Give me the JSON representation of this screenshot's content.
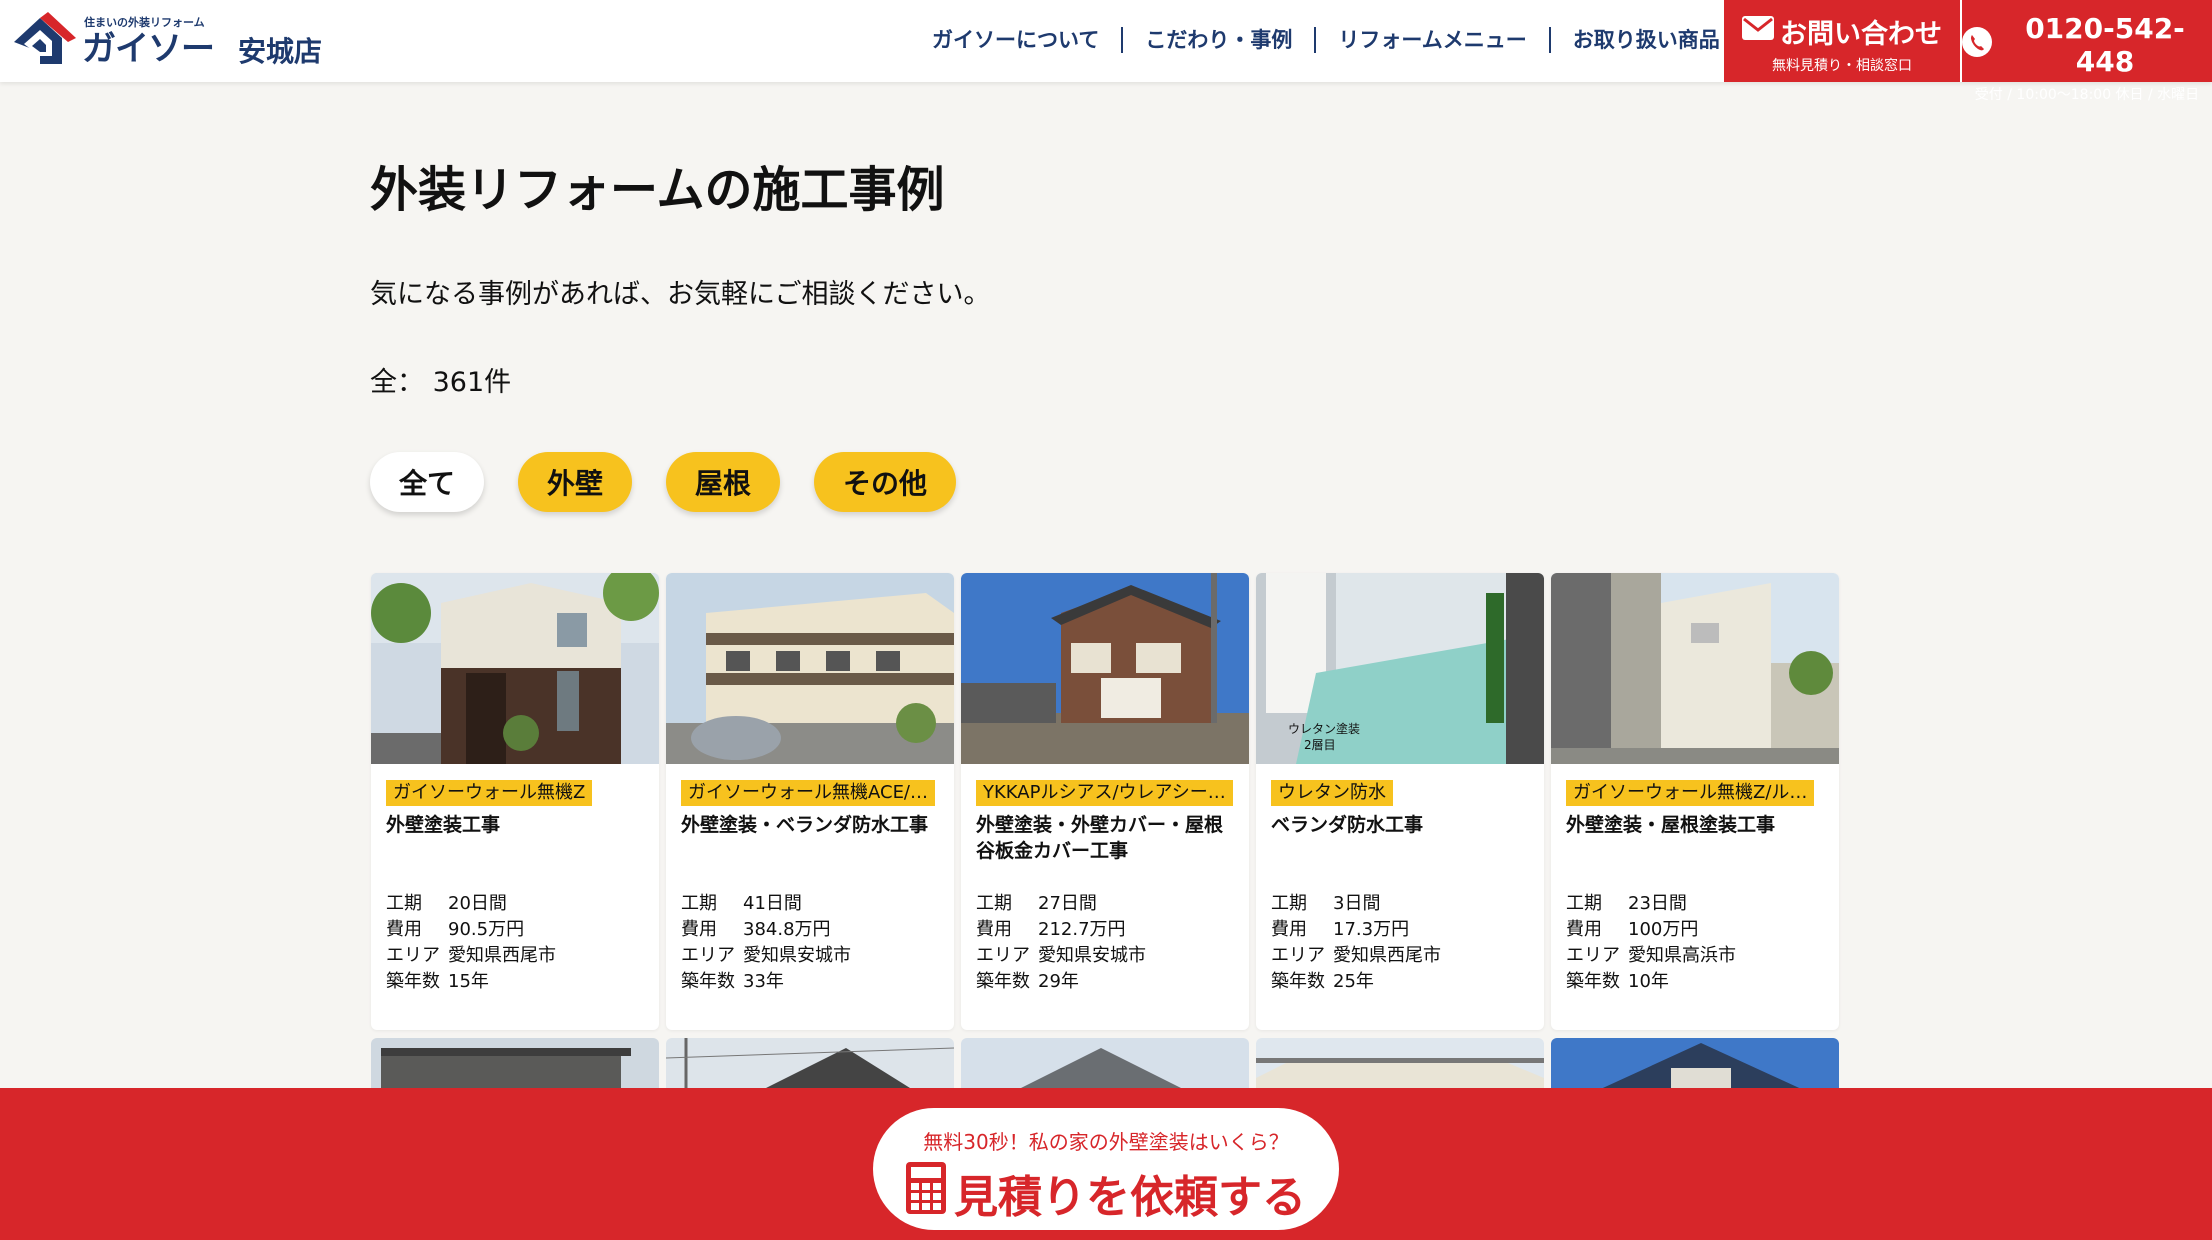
{
  "header": {
    "logo_tagline": "住まいの外装リフォーム",
    "logo_brand": "ガイソー",
    "store_name": "安城店",
    "nav": [
      "ガイソーについて",
      "こだわり・事例",
      "リフォームメニュー",
      "お取り扱い商品"
    ],
    "contact": {
      "label": "お問い合わせ",
      "sub": "無料見積り・相談窓口"
    },
    "tel": {
      "number": "0120-542-448",
      "sub": "受付 / 10:00〜18:00 休日 / 水曜日"
    }
  },
  "main": {
    "title": "外装リフォームの施工事例",
    "lead": "気になる事例があれば、お気軽にご相談ください。",
    "count": "全： 361件",
    "filters": [
      "全て",
      "外壁",
      "屋根",
      "その他"
    ]
  },
  "spec_labels": {
    "period": "工期",
    "cost": "費用",
    "area": "エリア",
    "age": "築年数"
  },
  "cases": [
    {
      "tag": "ガイソーウォール無機Z",
      "title": "外壁塗装工事",
      "period": "20日間",
      "cost": "90.5万円",
      "area": "愛知県西尾市",
      "age": "15年"
    },
    {
      "tag": "ガイソーウォール無機ACE/…",
      "title": "外壁塗装・ベランダ防水工事",
      "period": "41日間",
      "cost": "384.8万円",
      "area": "愛知県安城市",
      "age": "33年"
    },
    {
      "tag": "YKKAPルシアス/ウレアシー…",
      "title": "外壁塗装・外壁カバー・屋根谷板金カバー工事",
      "period": "27日間",
      "cost": "212.7万円",
      "area": "愛知県安城市",
      "age": "29年"
    },
    {
      "tag": "ウレタン防水",
      "title": "ベランダ防水工事",
      "period": "3日間",
      "cost": "17.3万円",
      "area": "愛知県西尾市",
      "age": "25年"
    },
    {
      "tag": "ガイソーウォール無機Z/ル…",
      "title": "外壁塗装・屋根塗装工事",
      "period": "23日間",
      "cost": "100万円",
      "area": "愛知県高浜市",
      "age": "10年"
    }
  ],
  "photo_sign": [
    "ウレタン塗装",
    "2層目"
  ],
  "bottom_cta": {
    "sub": "無料30秒！私の家の外壁塗装はいくら？",
    "main": "見積りを依頼する"
  },
  "colors": {
    "brand_navy": "#1e3a6e",
    "accent_red": "#d7262a",
    "tag_yellow": "#f7c21e",
    "page_bg": "#f6f5f2"
  }
}
